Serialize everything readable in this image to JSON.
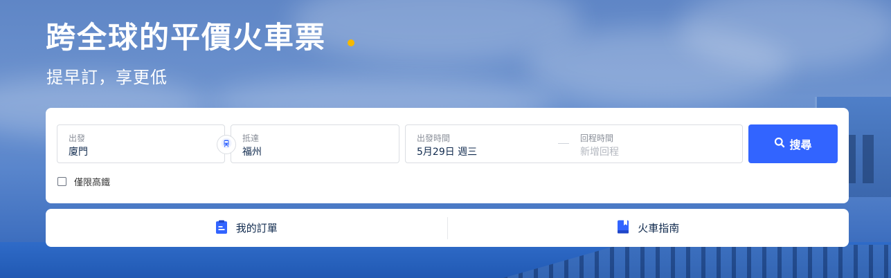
{
  "hero": {
    "title": "跨全球的平價火車票",
    "subtitle": "提早訂，享更低"
  },
  "search": {
    "from": {
      "label": "出發",
      "value": "廈門"
    },
    "to": {
      "label": "抵達",
      "value": "福州"
    },
    "depart": {
      "label": "出發時間",
      "value": "5月29日 週三"
    },
    "return": {
      "label": "回程時間",
      "placeholder": "新增回程"
    },
    "search_button": "搜尋",
    "hsr_only_label": "僅限高鐵",
    "hsr_only_checked": false
  },
  "links": {
    "my_orders": "我的訂單",
    "train_guide": "火車指南"
  },
  "icons": {
    "swap": "train-swap-icon",
    "search": "search-icon",
    "orders": "clipboard-icon",
    "guide": "book-icon"
  },
  "colors": {
    "accent": "#3264ff",
    "title_dot": "#f5b900",
    "text_dark": "#0f294d"
  }
}
